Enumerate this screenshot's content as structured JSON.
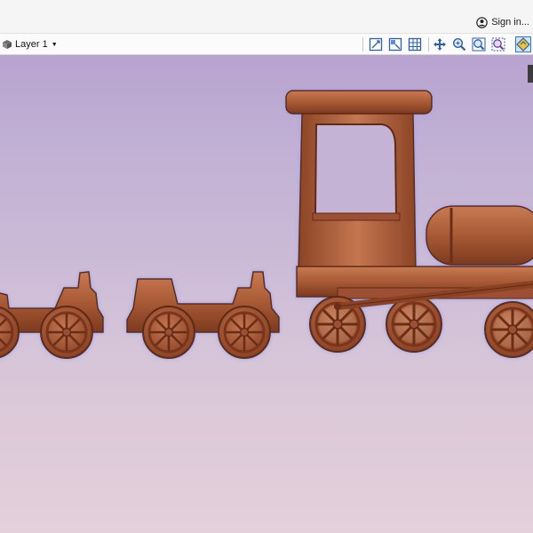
{
  "header": {
    "signin_label": "Sign in...",
    "user_icon": "user-circle-icon"
  },
  "toolbar": {
    "layer_label": "Layer 1",
    "layer_icon": "layer-stack-icon",
    "tools": [
      {
        "name": "view-fit-icon"
      },
      {
        "name": "view-grid-snap-icon"
      },
      {
        "name": "grid-icon"
      },
      {
        "name": "pan-icon"
      },
      {
        "name": "zoom-icon"
      },
      {
        "name": "zoom-extents-icon"
      },
      {
        "name": "zoom-selection-icon"
      },
      {
        "name": "render-3d-icon",
        "active": true
      }
    ]
  },
  "viewport": {
    "content": "3D wooden toy train relief",
    "colors": {
      "wood": "#a85a35",
      "wood_dark": "#5f2a14",
      "wood_light": "#c97a52",
      "background_top": "#b7a3cf",
      "background_bottom": "#e3d0db"
    }
  }
}
